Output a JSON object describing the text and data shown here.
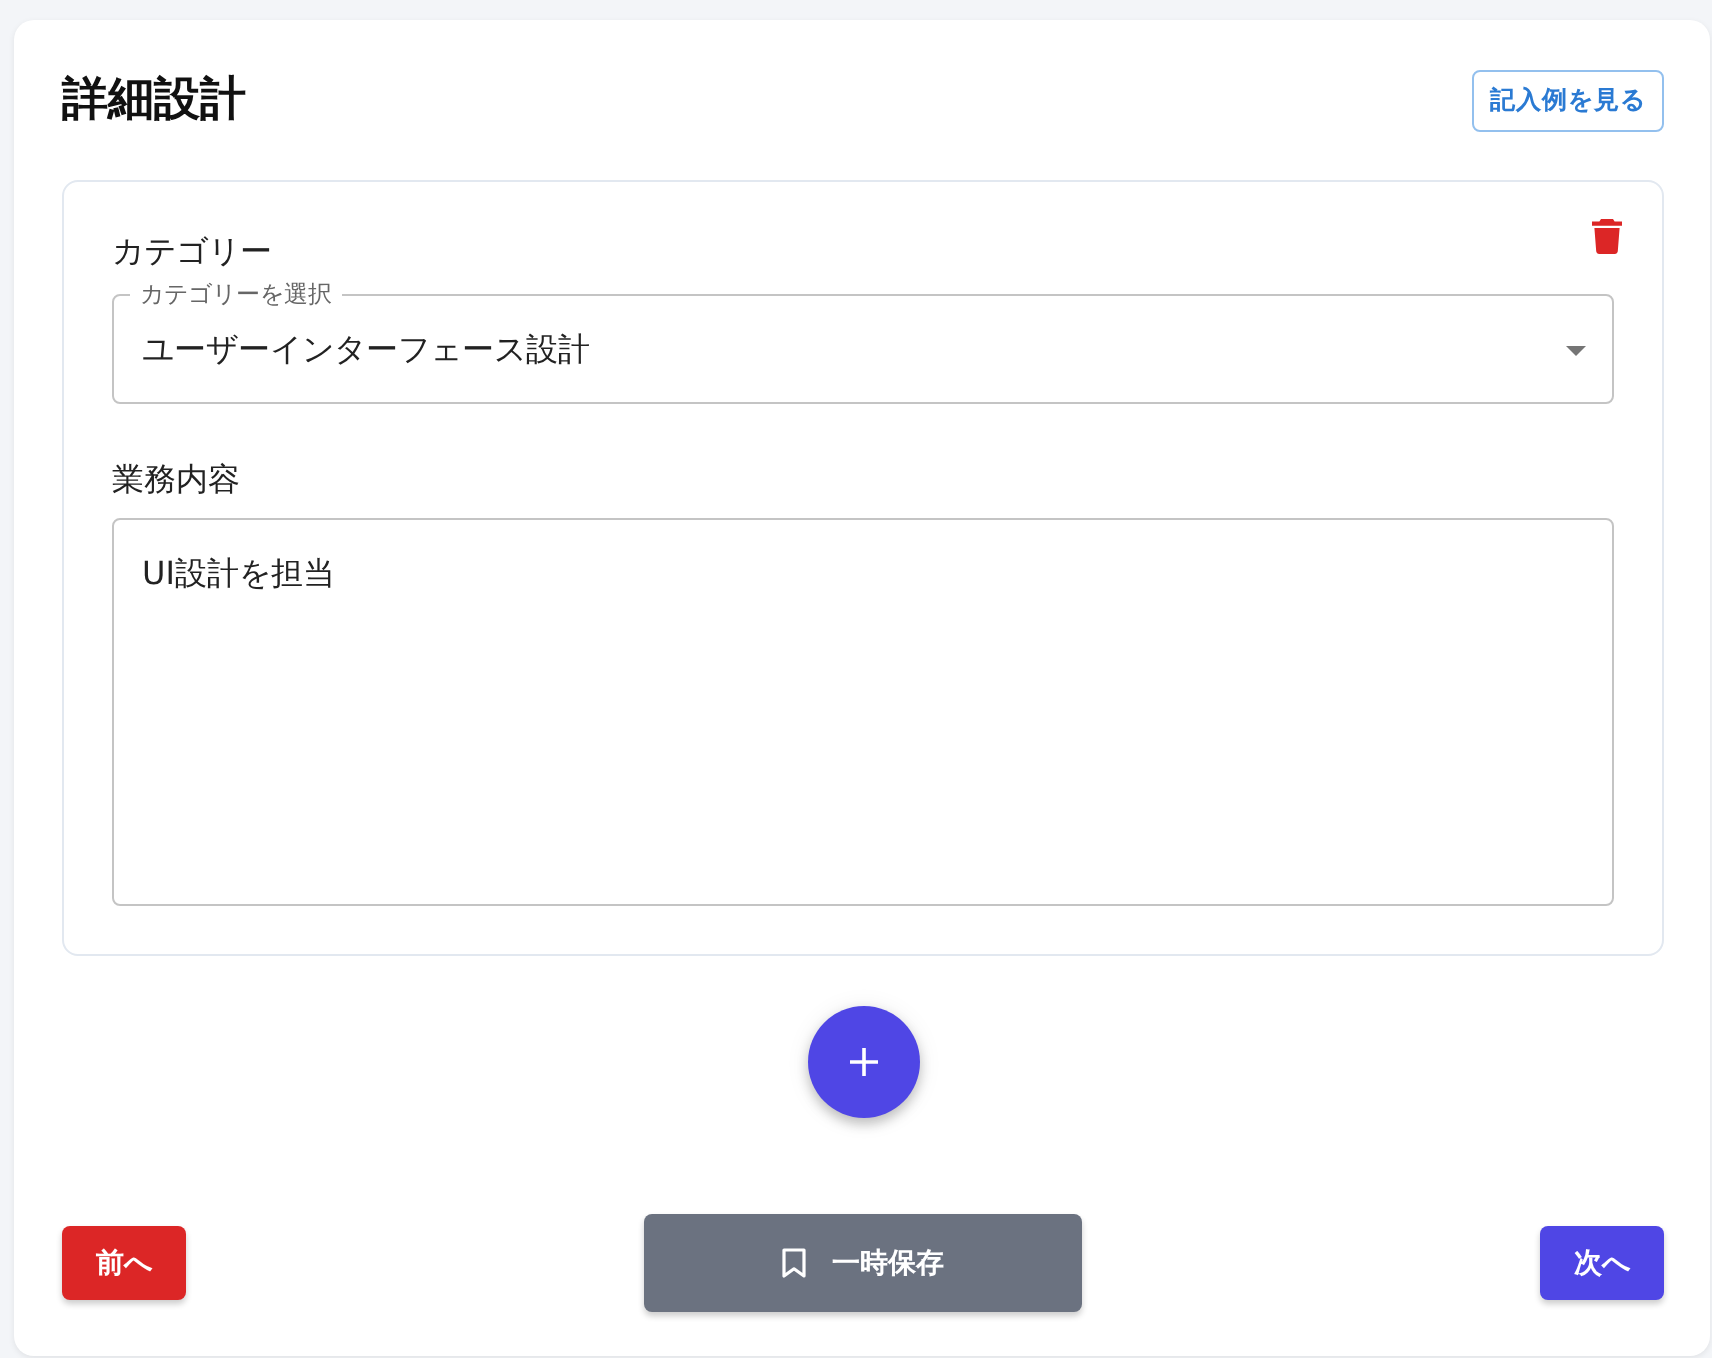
{
  "header": {
    "title": "詳細設計",
    "example_button": "記入例を見る"
  },
  "entries": [
    {
      "category_label": "カテゴリー",
      "category_select": {
        "floating_label": "カテゴリーを選択",
        "value": "ユーザーインターフェース設計"
      },
      "content_label": "業務内容",
      "content_field": {
        "value": "UI設計を担当"
      }
    }
  ],
  "footer": {
    "buttons": [
      {
        "kind": "back",
        "label": "前へ"
      },
      {
        "kind": "save",
        "label": "一時保存"
      },
      {
        "kind": "next",
        "label": "次へ"
      }
    ]
  }
}
